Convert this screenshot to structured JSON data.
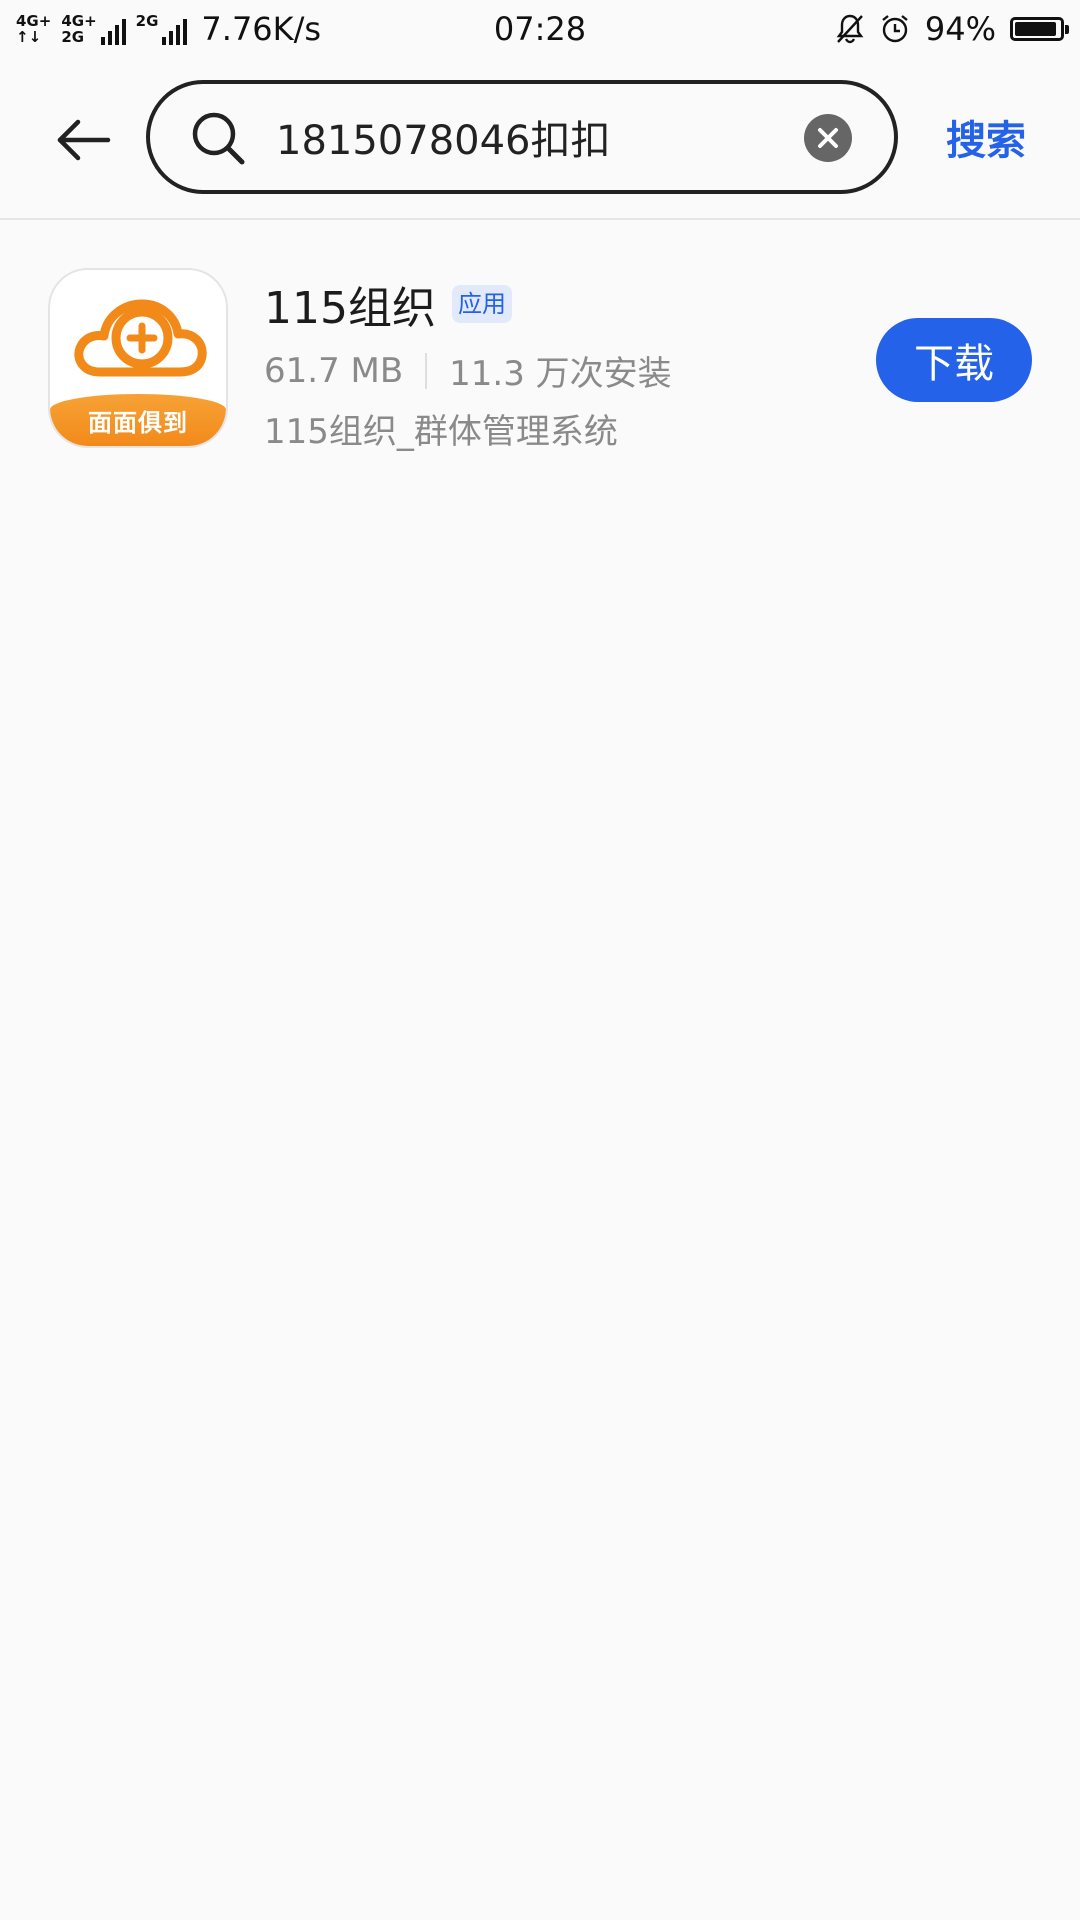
{
  "status_bar": {
    "network_1_top": "4G+",
    "network_1_bottom": "↑↓",
    "network_2_top": "4G+",
    "network_2_bottom": "2G",
    "network_3": "2G",
    "net_speed": "7.76K/s",
    "time": "07:28",
    "battery_percent": "94%",
    "battery_level": 0.94
  },
  "search": {
    "query": "1815078046扣扣",
    "submit_label": "搜索"
  },
  "results": [
    {
      "name": "115组织",
      "tag": "应用",
      "size": "61.7 MB",
      "installs": "11.3 万次安装",
      "description": "115组织_群体管理系统",
      "icon_caption": "面面俱到",
      "download_label": "下载"
    }
  ],
  "colors": {
    "accent": "#2462ea",
    "icon_orange": "#f28a1a",
    "background": "#fafafa"
  }
}
